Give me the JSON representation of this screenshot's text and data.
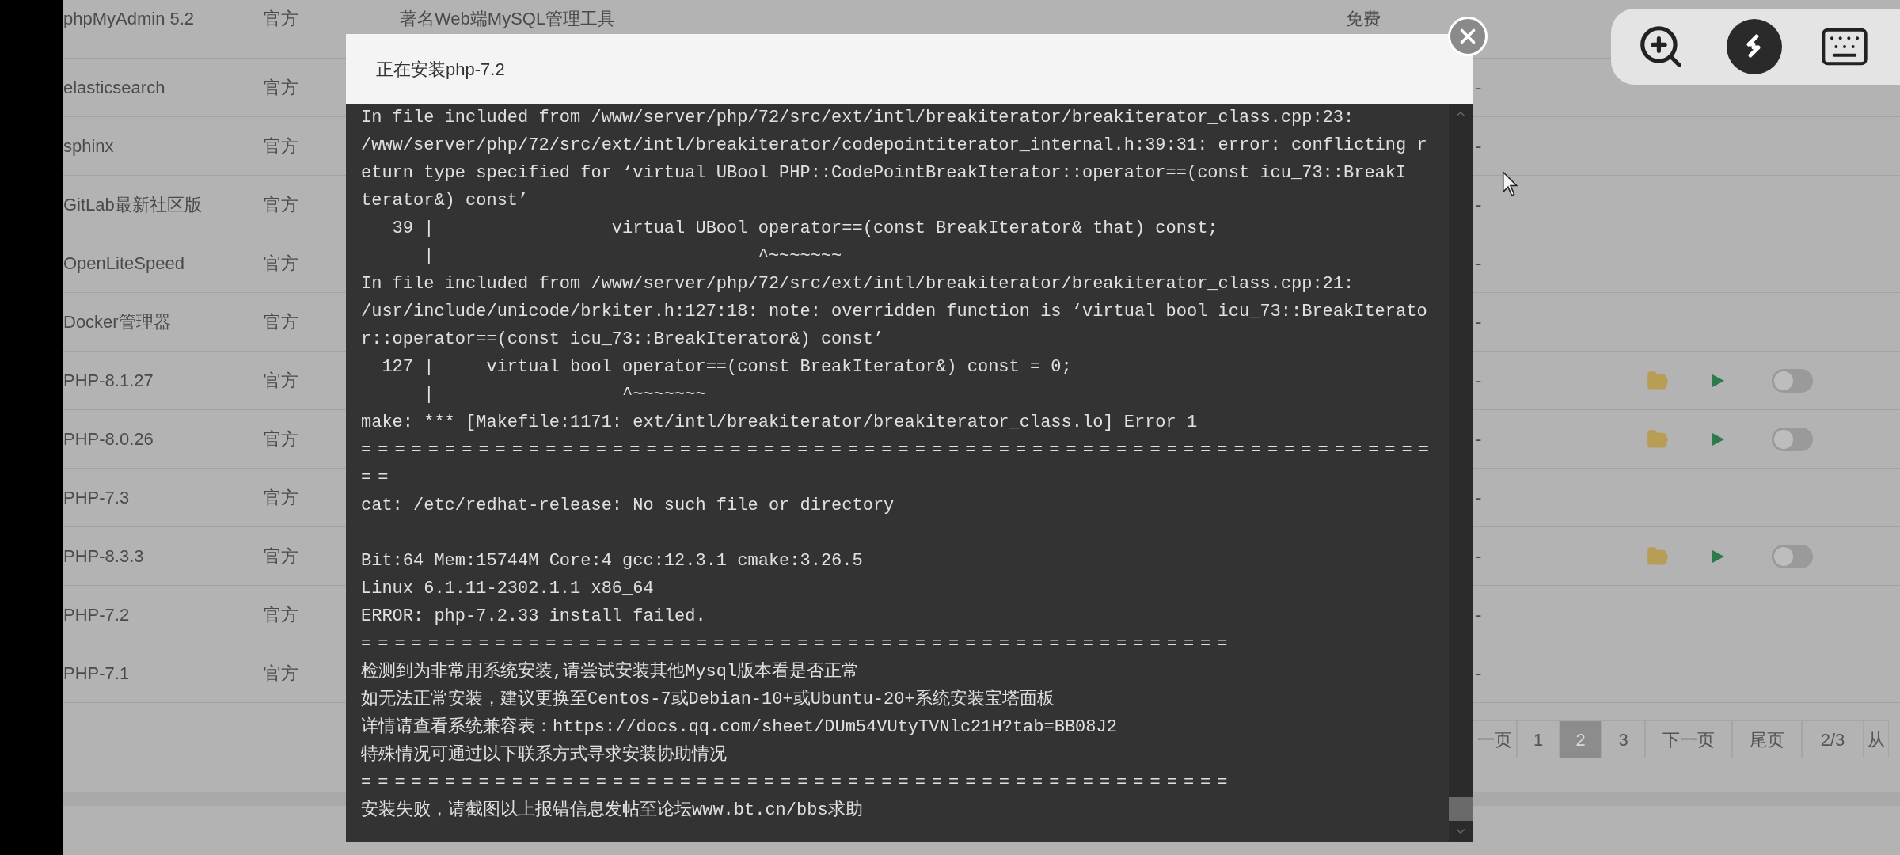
{
  "table": {
    "rows": [
      {
        "name": "phpMyAdmin 5.2",
        "source": "官方",
        "description": "著名Web端MySQL管理工具",
        "price": "免费"
      },
      {
        "name": "elasticsearch",
        "source": "官方",
        "column_5": "-"
      },
      {
        "name": "sphinx",
        "source": "官方",
        "column_5": "-"
      },
      {
        "name": "GitLab最新社区版",
        "source": "官方",
        "column_5": "-"
      },
      {
        "name": "OpenLiteSpeed",
        "source": "官方",
        "column_5": "-"
      },
      {
        "name": "Docker管理器",
        "source": "官方",
        "column_5": "-"
      },
      {
        "name": "PHP-8.1.27",
        "source": "官方",
        "column_5": "-",
        "actions": {
          "toggle_on": false
        }
      },
      {
        "name": "PHP-8.0.26",
        "source": "官方",
        "column_5": "-",
        "actions": {
          "toggle_on": false
        }
      },
      {
        "name": "PHP-7.3",
        "source": "官方",
        "column_5": "-"
      },
      {
        "name": "PHP-8.3.3",
        "source": "官方",
        "column_5": "-",
        "actions": {
          "toggle_on": false
        }
      },
      {
        "name": "PHP-7.2",
        "source": "官方",
        "column_5": "-"
      },
      {
        "name": "PHP-7.1",
        "source": "官方",
        "column_5": "-"
      }
    ]
  },
  "pagination": [
    {
      "label": "一页",
      "selected": false
    },
    {
      "label": "1",
      "selected": false
    },
    {
      "label": "2",
      "selected": true
    },
    {
      "label": "3",
      "selected": false
    },
    {
      "label": "下一页",
      "selected": false
    },
    {
      "label": "尾页",
      "selected": false
    },
    {
      "label": "2/3",
      "selected": false
    },
    {
      "label": "从",
      "selected": false
    }
  ],
  "modal": {
    "title": "正在安装php-7.2",
    "log": [
      {
        "kind": "text",
        "text": "In file included from /www/server/php/72/src/ext/intl/breakiterator/breakiterator_class.cpp:23:"
      },
      {
        "kind": "text",
        "text": "/www/server/php/72/src/ext/intl/breakiterator/codepointiterator_internal.h:39:31: error: conflicting r"
      },
      {
        "kind": "text",
        "text": "eturn type specified for ‘virtual UBool PHP::CodePointBreakIterator::operator==(const icu_73::BreakI"
      },
      {
        "kind": "text",
        "text": "terator&) const’"
      },
      {
        "kind": "text",
        "text": "   39 |                 virtual UBool operator==(const BreakIterator& that) const;"
      },
      {
        "kind": "text",
        "text": "      |                               ^~~~~~~~"
      },
      {
        "kind": "text",
        "text": "In file included from /www/server/php/72/src/ext/intl/breakiterator/breakiterator_class.cpp:21:"
      },
      {
        "kind": "text",
        "text": "/usr/include/unicode/brkiter.h:127:18: note: overridden function is ‘virtual bool icu_73::BreakIterato"
      },
      {
        "kind": "text",
        "text": "r::operator==(const icu_73::BreakIterator&) const’"
      },
      {
        "kind": "text",
        "text": "  127 |     virtual bool operator==(const BreakIterator&) const = 0;"
      },
      {
        "kind": "text",
        "text": "      |                  ^~~~~~~~"
      },
      {
        "kind": "text",
        "text": "make: *** [Makefile:1171: ext/intl/breakiterator/breakiterator_class.lo] Error 1"
      },
      {
        "kind": "rule",
        "text": "================================================================"
      },
      {
        "kind": "rule",
        "text": "=="
      },
      {
        "kind": "text",
        "text": "cat: /etc/redhat-release: No such file or directory"
      },
      {
        "kind": "blank"
      },
      {
        "kind": "text",
        "text": "Bit:64 Mem:15744M Core:4 gcc:12.3.1 cmake:3.26.5"
      },
      {
        "kind": "text",
        "text": "Linux 6.1.11-2302.1.1 x86_64"
      },
      {
        "kind": "text",
        "text": "ERROR: php-7.2.33 install failed."
      },
      {
        "kind": "rule",
        "text": "===================================================="
      },
      {
        "kind": "text",
        "text": "检测到为非常用系统安装,请尝试安装其他Mysql版本看是否正常"
      },
      {
        "kind": "text",
        "text": "如无法正常安装，建议更换至Centos-7或Debian-10+或Ubuntu-20+系统安装宝塔面板"
      },
      {
        "kind": "text",
        "text": "详情请查看系统兼容表：https://docs.qq.com/sheet/DUm54VUtyTVNlc21H?tab=BB08J2"
      },
      {
        "kind": "text",
        "text": "特殊情况可通过以下联系方式寻求安装协助情况"
      },
      {
        "kind": "rule",
        "text": "===================================================="
      },
      {
        "kind": "text",
        "text": "安装失败，请截图以上报错信息发帖至论坛www.bt.cn/bbs求助"
      }
    ]
  }
}
